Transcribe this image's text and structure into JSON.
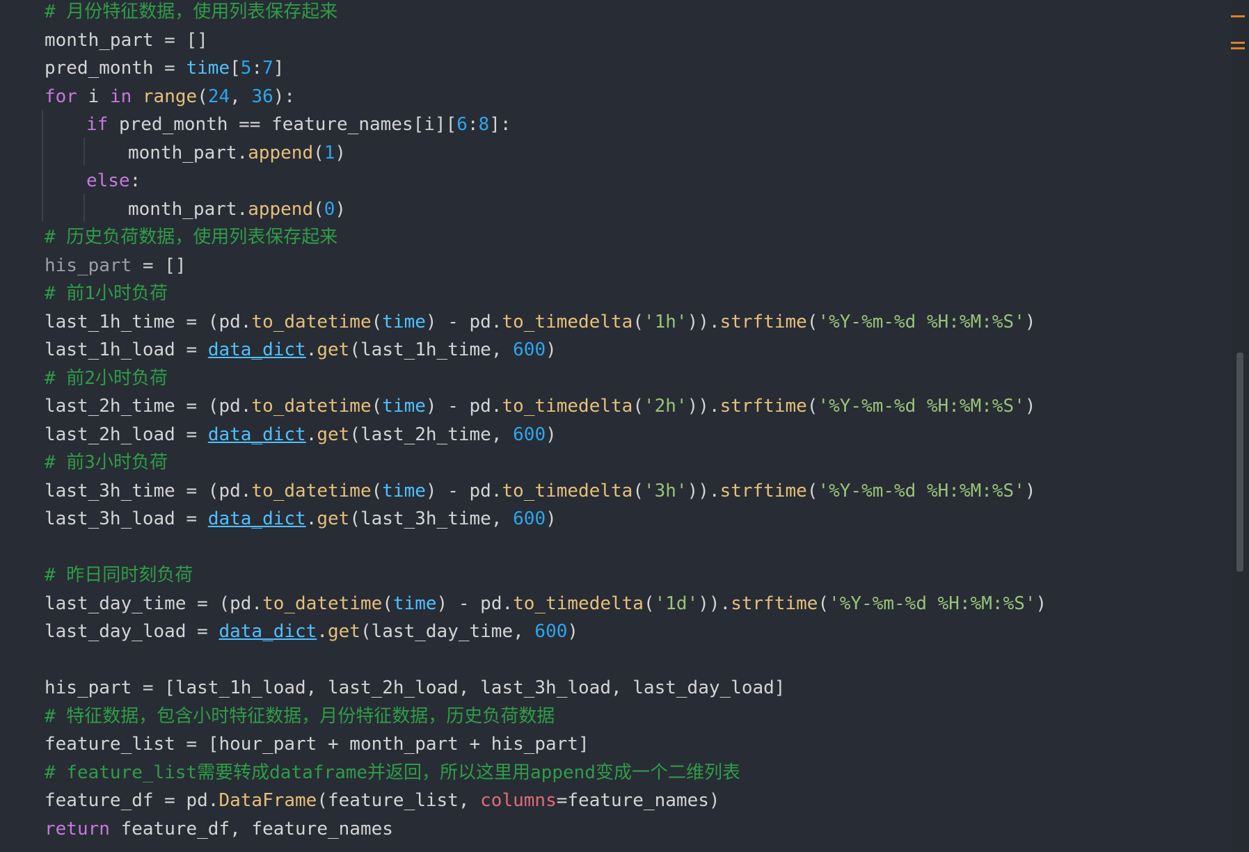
{
  "editor": {
    "language": "python",
    "theme_colors": {
      "background": "#282c34",
      "comment": "#2e9d47",
      "keyword": "#c678dd",
      "builtin": "#4fc1ff",
      "function": "#e5c07b",
      "number": "#2aa7f0",
      "string": "#98c379",
      "parameter": "#e06c75",
      "text": "#d4d4d4",
      "scrollbar_marker": "#d9822b"
    },
    "lines": [
      {
        "indent": 0,
        "tokens": [
          {
            "t": "# 月份特征数据，使用列表保存起来",
            "c": "cm"
          }
        ]
      },
      {
        "indent": 0,
        "tokens": [
          {
            "t": "month_part = []",
            "c": "pn"
          }
        ]
      },
      {
        "indent": 0,
        "tokens": [
          {
            "t": "pred_month = ",
            "c": "pn"
          },
          {
            "t": "time",
            "c": "bi"
          },
          {
            "t": "[",
            "c": "pn"
          },
          {
            "t": "5",
            "c": "nm"
          },
          {
            "t": ":",
            "c": "pn"
          },
          {
            "t": "7",
            "c": "nm"
          },
          {
            "t": "]",
            "c": "pn"
          }
        ]
      },
      {
        "indent": 0,
        "tokens": [
          {
            "t": "for",
            "c": "kw"
          },
          {
            "t": " i ",
            "c": "pn"
          },
          {
            "t": "in",
            "c": "kw"
          },
          {
            "t": " ",
            "c": "pn"
          },
          {
            "t": "range",
            "c": "fn"
          },
          {
            "t": "(",
            "c": "pn"
          },
          {
            "t": "24",
            "c": "nm"
          },
          {
            "t": ", ",
            "c": "pn"
          },
          {
            "t": "36",
            "c": "nm"
          },
          {
            "t": "):",
            "c": "pn"
          }
        ]
      },
      {
        "indent": 1,
        "tokens": [
          {
            "t": "if",
            "c": "kw"
          },
          {
            "t": " pred_month == feature_names[i][",
            "c": "pn"
          },
          {
            "t": "6",
            "c": "nm"
          },
          {
            "t": ":",
            "c": "pn"
          },
          {
            "t": "8",
            "c": "nm"
          },
          {
            "t": "]:",
            "c": "pn"
          }
        ]
      },
      {
        "indent": 2,
        "tokens": [
          {
            "t": "month_part.",
            "c": "pn"
          },
          {
            "t": "append",
            "c": "fn"
          },
          {
            "t": "(",
            "c": "pn"
          },
          {
            "t": "1",
            "c": "nm"
          },
          {
            "t": ")",
            "c": "pn"
          }
        ]
      },
      {
        "indent": 1,
        "tokens": [
          {
            "t": "else",
            "c": "kw"
          },
          {
            "t": ":",
            "c": "pn"
          }
        ]
      },
      {
        "indent": 2,
        "tokens": [
          {
            "t": "month_part.",
            "c": "pn"
          },
          {
            "t": "append",
            "c": "fn"
          },
          {
            "t": "(",
            "c": "pn"
          },
          {
            "t": "0",
            "c": "nm"
          },
          {
            "t": ")",
            "c": "pn"
          }
        ]
      },
      {
        "indent": 0,
        "tokens": [
          {
            "t": "# 历史负荷数据，使用列表保存起来",
            "c": "cm"
          }
        ]
      },
      {
        "indent": 0,
        "tokens": [
          {
            "t": "his_part",
            "c": "dim"
          },
          {
            "t": " = []",
            "c": "pn"
          }
        ]
      },
      {
        "indent": 0,
        "tokens": [
          {
            "t": "# 前1小时负荷",
            "c": "cm"
          }
        ]
      },
      {
        "indent": 0,
        "tokens": [
          {
            "t": "last_1h_time = (pd.",
            "c": "pn"
          },
          {
            "t": "to_datetime",
            "c": "fn"
          },
          {
            "t": "(",
            "c": "pn"
          },
          {
            "t": "time",
            "c": "bi"
          },
          {
            "t": ") - pd.",
            "c": "pn"
          },
          {
            "t": "to_timedelta",
            "c": "fn"
          },
          {
            "t": "(",
            "c": "pn"
          },
          {
            "t": "'1h'",
            "c": "st"
          },
          {
            "t": ")).",
            "c": "pn"
          },
          {
            "t": "strftime",
            "c": "fn"
          },
          {
            "t": "(",
            "c": "pn"
          },
          {
            "t": "'%Y-%m-%d %H:%M:%S'",
            "c": "st"
          },
          {
            "t": ")",
            "c": "pn"
          }
        ]
      },
      {
        "indent": 0,
        "tokens": [
          {
            "t": "last_1h_load = ",
            "c": "pn"
          },
          {
            "t": "data_dict",
            "c": "ul"
          },
          {
            "t": ".",
            "c": "pn"
          },
          {
            "t": "get",
            "c": "fn"
          },
          {
            "t": "(last_1h_time, ",
            "c": "pn"
          },
          {
            "t": "600",
            "c": "nm"
          },
          {
            "t": ")",
            "c": "pn"
          }
        ]
      },
      {
        "indent": 0,
        "tokens": [
          {
            "t": "# 前2小时负荷",
            "c": "cm"
          }
        ]
      },
      {
        "indent": 0,
        "tokens": [
          {
            "t": "last_2h_time = (pd.",
            "c": "pn"
          },
          {
            "t": "to_datetime",
            "c": "fn"
          },
          {
            "t": "(",
            "c": "pn"
          },
          {
            "t": "time",
            "c": "bi"
          },
          {
            "t": ") - pd.",
            "c": "pn"
          },
          {
            "t": "to_timedelta",
            "c": "fn"
          },
          {
            "t": "(",
            "c": "pn"
          },
          {
            "t": "'2h'",
            "c": "st"
          },
          {
            "t": ")).",
            "c": "pn"
          },
          {
            "t": "strftime",
            "c": "fn"
          },
          {
            "t": "(",
            "c": "pn"
          },
          {
            "t": "'%Y-%m-%d %H:%M:%S'",
            "c": "st"
          },
          {
            "t": ")",
            "c": "pn"
          }
        ]
      },
      {
        "indent": 0,
        "tokens": [
          {
            "t": "last_2h_load = ",
            "c": "pn"
          },
          {
            "t": "data_dict",
            "c": "ul"
          },
          {
            "t": ".",
            "c": "pn"
          },
          {
            "t": "get",
            "c": "fn"
          },
          {
            "t": "(last_2h_time, ",
            "c": "pn"
          },
          {
            "t": "600",
            "c": "nm"
          },
          {
            "t": ")",
            "c": "pn"
          }
        ]
      },
      {
        "indent": 0,
        "tokens": [
          {
            "t": "# 前3小时负荷",
            "c": "cm"
          }
        ]
      },
      {
        "indent": 0,
        "tokens": [
          {
            "t": "last_3h_time = (pd.",
            "c": "pn"
          },
          {
            "t": "to_datetime",
            "c": "fn"
          },
          {
            "t": "(",
            "c": "pn"
          },
          {
            "t": "time",
            "c": "bi"
          },
          {
            "t": ") - pd.",
            "c": "pn"
          },
          {
            "t": "to_timedelta",
            "c": "fn"
          },
          {
            "t": "(",
            "c": "pn"
          },
          {
            "t": "'3h'",
            "c": "st"
          },
          {
            "t": ")).",
            "c": "pn"
          },
          {
            "t": "strftime",
            "c": "fn"
          },
          {
            "t": "(",
            "c": "pn"
          },
          {
            "t": "'%Y-%m-%d %H:%M:%S'",
            "c": "st"
          },
          {
            "t": ")",
            "c": "pn"
          }
        ]
      },
      {
        "indent": 0,
        "tokens": [
          {
            "t": "last_3h_load = ",
            "c": "pn"
          },
          {
            "t": "data_dict",
            "c": "ul"
          },
          {
            "t": ".",
            "c": "pn"
          },
          {
            "t": "get",
            "c": "fn"
          },
          {
            "t": "(last_3h_time, ",
            "c": "pn"
          },
          {
            "t": "600",
            "c": "nm"
          },
          {
            "t": ")",
            "c": "pn"
          }
        ]
      },
      {
        "indent": 0,
        "tokens": []
      },
      {
        "indent": 0,
        "tokens": [
          {
            "t": "# 昨日同时刻负荷",
            "c": "cm"
          }
        ]
      },
      {
        "indent": 0,
        "tokens": [
          {
            "t": "last_day_time = (pd.",
            "c": "pn"
          },
          {
            "t": "to_datetime",
            "c": "fn"
          },
          {
            "t": "(",
            "c": "pn"
          },
          {
            "t": "time",
            "c": "bi"
          },
          {
            "t": ") - pd.",
            "c": "pn"
          },
          {
            "t": "to_timedelta",
            "c": "fn"
          },
          {
            "t": "(",
            "c": "pn"
          },
          {
            "t": "'1d'",
            "c": "st"
          },
          {
            "t": ")).",
            "c": "pn"
          },
          {
            "t": "strftime",
            "c": "fn"
          },
          {
            "t": "(",
            "c": "pn"
          },
          {
            "t": "'%Y-%m-%d %H:%M:%S'",
            "c": "st"
          },
          {
            "t": ")",
            "c": "pn"
          }
        ]
      },
      {
        "indent": 0,
        "tokens": [
          {
            "t": "last_day_load = ",
            "c": "pn"
          },
          {
            "t": "data_dict",
            "c": "ul"
          },
          {
            "t": ".",
            "c": "pn"
          },
          {
            "t": "get",
            "c": "fn"
          },
          {
            "t": "(last_day_time, ",
            "c": "pn"
          },
          {
            "t": "600",
            "c": "nm"
          },
          {
            "t": ")",
            "c": "pn"
          }
        ]
      },
      {
        "indent": 0,
        "tokens": []
      },
      {
        "indent": 0,
        "tokens": [
          {
            "t": "his_part = [last_1h_load, last_2h_load, last_3h_load, last_day_load]",
            "c": "pn"
          }
        ]
      },
      {
        "indent": 0,
        "tokens": [
          {
            "t": "# 特征数据，包含小时特征数据，月份特征数据，历史负荷数据",
            "c": "cm"
          }
        ]
      },
      {
        "indent": 0,
        "tokens": [
          {
            "t": "feature_list = [hour_part + month_part + his_part]",
            "c": "pn"
          }
        ]
      },
      {
        "indent": 0,
        "tokens": [
          {
            "t": "# feature_list需要转成dataframe并返回，所以这里用append变成一个二维列表",
            "c": "cm"
          }
        ]
      },
      {
        "indent": 0,
        "tokens": [
          {
            "t": "feature_df = pd.",
            "c": "pn"
          },
          {
            "t": "DataFrame",
            "c": "fn"
          },
          {
            "t": "(feature_list, ",
            "c": "pn"
          },
          {
            "t": "columns",
            "c": "pm"
          },
          {
            "t": "=feature_names)",
            "c": "pn"
          }
        ]
      },
      {
        "indent": 0,
        "tokens": [
          {
            "t": "return",
            "c": "kw"
          },
          {
            "t": " feature_df, feature_names",
            "c": "pn"
          }
        ]
      }
    ]
  }
}
